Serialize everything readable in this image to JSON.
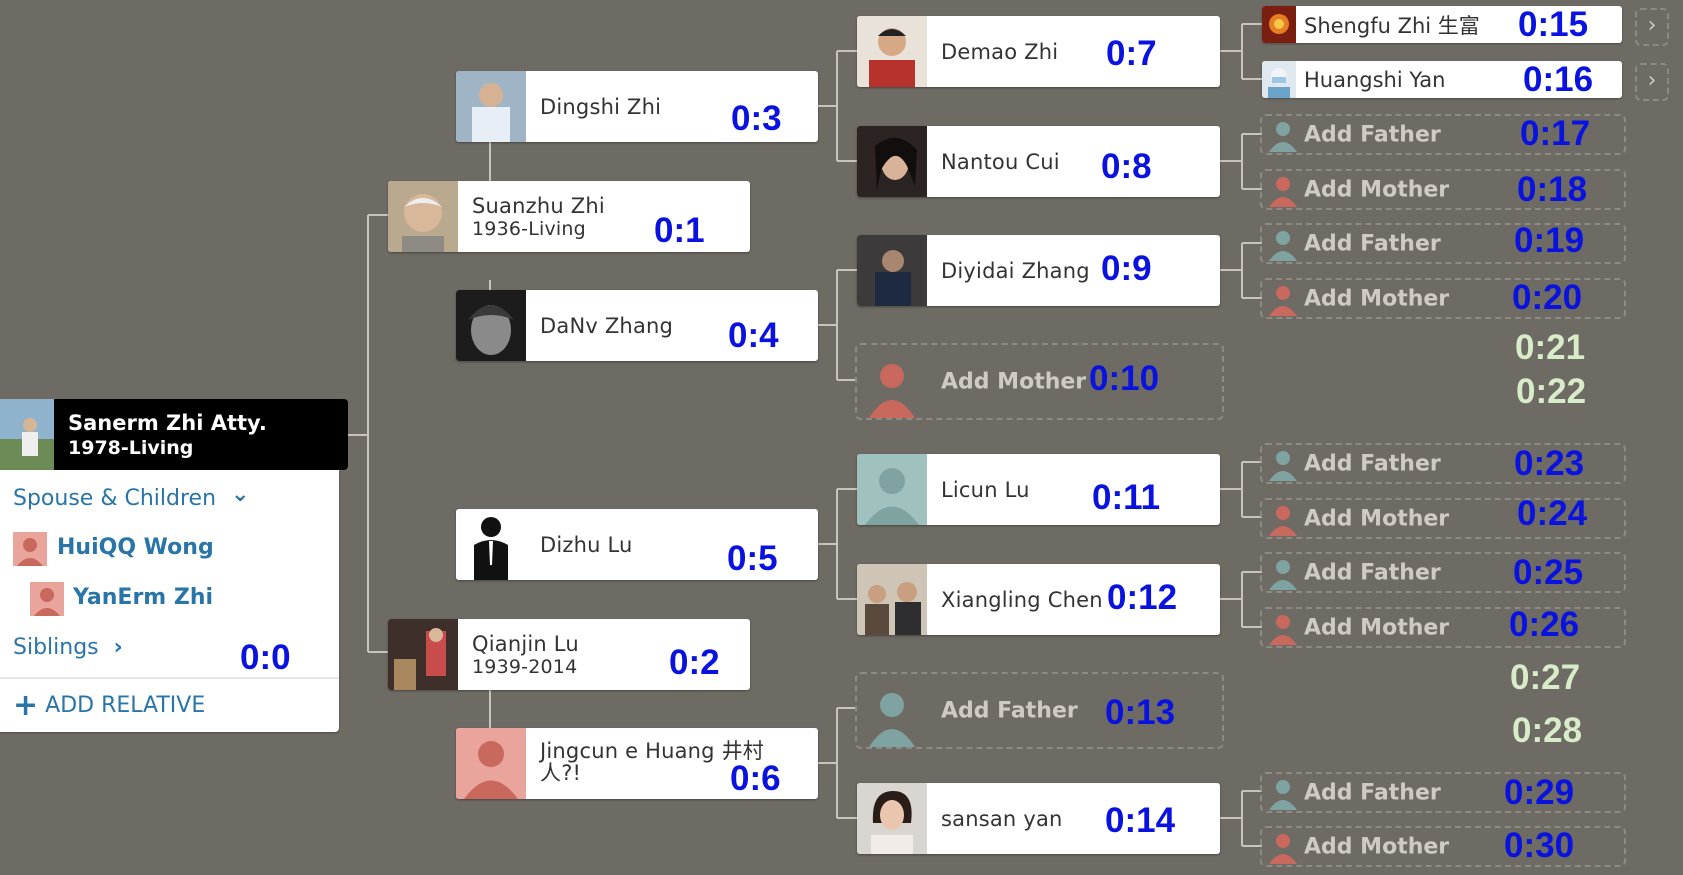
{
  "colors": {
    "background": "#6e6a64",
    "link": "#2a75a8",
    "code": "#0a12e0",
    "code_light": "#d9ecc9",
    "female_placeholder": "#d98c84",
    "male_placeholder": "#7fa3a1"
  },
  "focus": {
    "name": "Sanerm Zhi Atty.",
    "years": "1978-Living",
    "code": "0:0"
  },
  "panel": {
    "spouse_children": "Spouse & Children",
    "spouse": "HuiQQ Wong",
    "child": "YanErm Zhi",
    "siblings": "Siblings",
    "add_relative": "ADD RELATIVE"
  },
  "gen1": [
    {
      "name": "Suanzhu Zhi",
      "years": "1936-Living",
      "code": "0:1"
    },
    {
      "name": "Qianjin Lu",
      "years": "1939-2014",
      "code": "0:2"
    }
  ],
  "gen2": [
    {
      "name": "Dingshi Zhi",
      "code": "0:3"
    },
    {
      "name": "DaNv Zhang",
      "code": "0:4"
    },
    {
      "name": "Dizhu Lu",
      "code": "0:5"
    },
    {
      "name": "Jingcun e Huang 井村人?!",
      "code": "0:6"
    }
  ],
  "gen3": [
    {
      "name": "Demao Zhi",
      "code": "0:7"
    },
    {
      "name": "Nantou Cui",
      "code": "0:8"
    },
    {
      "name": "Diyidai Zhang",
      "code": "0:9"
    },
    {
      "name": "Add Mother",
      "code": "0:10"
    },
    {
      "name": "Licun Lu",
      "code": "0:11"
    },
    {
      "name": "Xiangling Chen",
      "code": "0:12"
    },
    {
      "name": "Add Father",
      "code": "0:13"
    },
    {
      "name": "sansan yan",
      "code": "0:14"
    }
  ],
  "gen4": [
    {
      "name": "Shengfu Zhi 生富",
      "code": "0:15"
    },
    {
      "name": "Huangshi Yan",
      "code": "0:16"
    },
    {
      "name": "Add Father",
      "code": "0:17"
    },
    {
      "name": "Add Mother",
      "code": "0:18"
    },
    {
      "name": "Add Father",
      "code": "0:19"
    },
    {
      "name": "Add Mother",
      "code": "0:20"
    },
    {
      "name": "",
      "code": "0:21"
    },
    {
      "name": "",
      "code": "0:22"
    },
    {
      "name": "Add Father",
      "code": "0:23"
    },
    {
      "name": "Add Mother",
      "code": "0:24"
    },
    {
      "name": "Add Father",
      "code": "0:25"
    },
    {
      "name": "Add Mother",
      "code": "0:26"
    },
    {
      "name": "",
      "code": "0:27"
    },
    {
      "name": "",
      "code": "0:28"
    },
    {
      "name": "Add Father",
      "code": "0:29"
    },
    {
      "name": "Add Mother",
      "code": "0:30"
    }
  ],
  "icons": {
    "chevron_right": "›",
    "chevron_down": "⌄",
    "plus": "+"
  }
}
